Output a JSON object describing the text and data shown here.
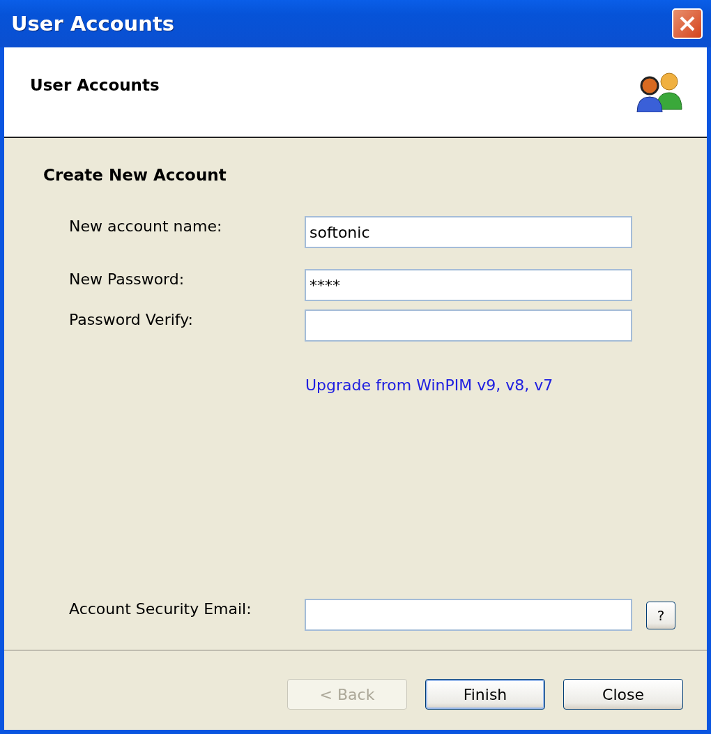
{
  "window": {
    "title": "User Accounts"
  },
  "header": {
    "title": "User Accounts"
  },
  "section": {
    "title": "Create New Account"
  },
  "fields": [
    {
      "label": "New account name:",
      "value": "softonic"
    },
    {
      "label": "New Password:",
      "value": "****"
    },
    {
      "label": "Password Verify:"
    }
  ],
  "link": "Upgrade from WinPIM v9, v8, v7",
  "email_field": {
    "label": "Account Security Email:",
    "help": true,
    "help_label": "?"
  },
  "buttons": [
    {
      "label": "< Back",
      "disabled": true,
      "default": false
    },
    {
      "label": "Finish",
      "disabled": false,
      "default": true
    },
    {
      "label": "Close",
      "disabled": false,
      "default": false
    }
  ]
}
